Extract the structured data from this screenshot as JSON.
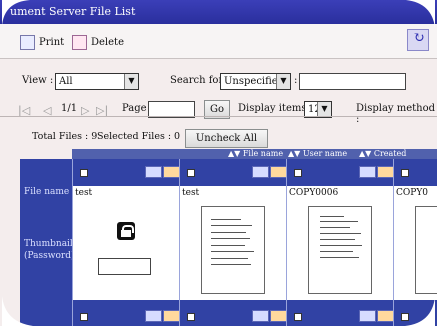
{
  "title": "ument Server File List",
  "toolbar": {
    "print_label": "Print",
    "delete_label": "Delete"
  },
  "filters": {
    "view_label": "View :",
    "view_value": "All",
    "search_for_label": "Search for :",
    "search_for_value": "Unspecified",
    "colon_label": ":"
  },
  "pager": {
    "page_text": "1/1",
    "page_label": "Page :",
    "go_label": "Go",
    "display_items_label": "Display items :",
    "display_items_value": "12",
    "display_method_label": "Display method :"
  },
  "summary": {
    "total_files": "Total Files : 9",
    "selected_files": "Selected Files : 0",
    "uncheck_all_label": "Uncheck All"
  },
  "columns": {
    "file_name": "File name",
    "user_name": "User name",
    "created": "Created"
  },
  "rows": {
    "file_name_label": "File name",
    "thumbnails_label": "Thumbnails",
    "password_label": "(Password)"
  },
  "files": [
    {
      "name": "test"
    },
    {
      "name": "test"
    },
    {
      "name": "COPY0006"
    },
    {
      "name": "COPY0"
    }
  ],
  "icons": {
    "print": "print-icon",
    "delete": "delete-icon",
    "refresh": "refresh-icon",
    "lock": "lock-icon",
    "copy": "copy-icon",
    "scan": "scan-icon"
  },
  "colors": {
    "title_blue": "#2a2f9d",
    "grid_blue": "#3142a4",
    "header_blue": "#5161ad"
  }
}
